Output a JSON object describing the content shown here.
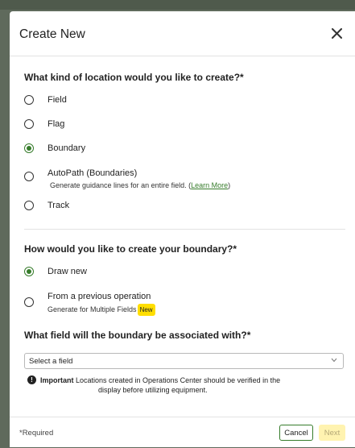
{
  "modal": {
    "title": "Create New",
    "close_icon": "close-icon"
  },
  "location_question": {
    "title": "What kind of location would you like to create?*",
    "options": [
      {
        "label": "Field",
        "selected": false
      },
      {
        "label": "Flag",
        "selected": false
      },
      {
        "label": "Boundary",
        "selected": true
      },
      {
        "label": "AutoPath (Boundaries)",
        "selected": false,
        "sub_text": "Generate guidance lines for an entire field. (",
        "sub_link": "Learn More",
        "sub_end": ")"
      },
      {
        "label": "Track",
        "selected": false
      }
    ]
  },
  "boundary_question": {
    "title": "How would you like to create your boundary?*",
    "options": [
      {
        "label": "Draw new",
        "selected": true
      },
      {
        "label": "From a previous operation",
        "selected": false,
        "sub_text": "Generate for Multiple Fields",
        "badge": "New"
      }
    ]
  },
  "field_question": {
    "title": "What field will the boundary be associated with?*",
    "select_value": "Select a field"
  },
  "notice": {
    "icon": "exclamation-icon",
    "bold": "Important",
    "text_line1": " Locations created in Operations Center should be verified in the",
    "text_line2": "display before utilizing equipment."
  },
  "footer": {
    "required_note": "*Required",
    "cancel_label": "Cancel",
    "next_label": "Next"
  },
  "colors": {
    "accent": "#367c2b",
    "next_disabled_bg": "#fff3b0",
    "badge": "#ffde00"
  }
}
